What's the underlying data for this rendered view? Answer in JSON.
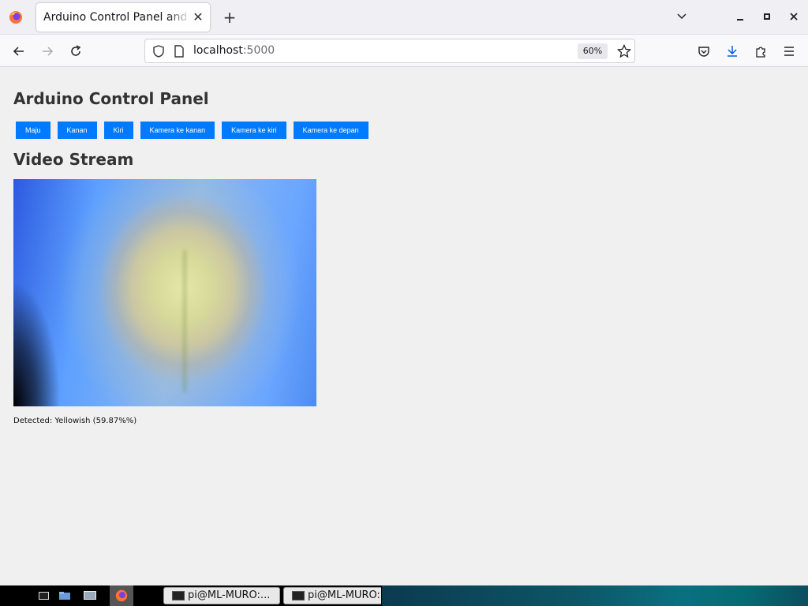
{
  "browser": {
    "tab_title": "Arduino Control Panel and Video Stream",
    "url_host": "localhost",
    "url_port": ":5000",
    "zoom": "60%"
  },
  "page": {
    "title": "Arduino Control Panel",
    "buttons": [
      "Maju",
      "Kanan",
      "Kiri",
      "Kamera ke kanan",
      "Kamera ke kiri",
      "Kamera ke depan"
    ],
    "video_heading": "Video Stream",
    "detected_text": "Detected: Yellowish (59.87%%)"
  },
  "taskbar": {
    "tasks": [
      "pi@ML-MURO:...",
      "pi@ML-MURO:"
    ]
  },
  "colors": {
    "button_bg": "#007bff",
    "heading": "#333333"
  }
}
